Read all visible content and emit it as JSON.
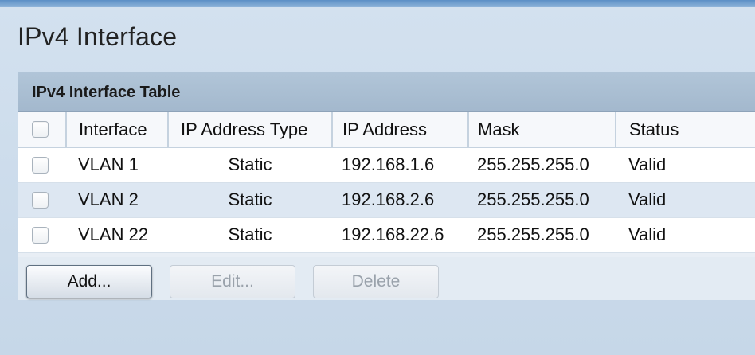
{
  "page": {
    "title": "IPv4 Interface"
  },
  "table": {
    "title": "IPv4 Interface Table",
    "columns": {
      "interface": "Interface",
      "ip_address_type": "IP Address Type",
      "ip_address": "IP Address",
      "mask": "Mask",
      "status": "Status"
    },
    "rows": [
      {
        "interface": "VLAN 1",
        "ip_address_type": "Static",
        "ip_address": "192.168.1.6",
        "mask": "255.255.255.0",
        "status": "Valid",
        "selected": false
      },
      {
        "interface": "VLAN 2",
        "ip_address_type": "Static",
        "ip_address": "192.168.2.6",
        "mask": "255.255.255.0",
        "status": "Valid",
        "selected": false
      },
      {
        "interface": "VLAN 22",
        "ip_address_type": "Static",
        "ip_address": "192.168.22.6",
        "mask": "255.255.255.0",
        "status": "Valid",
        "selected": false
      }
    ]
  },
  "buttons": {
    "add_label": "Add...",
    "edit_label": "Edit...",
    "delete_label": "Delete",
    "edit_enabled": false,
    "delete_enabled": false
  },
  "colors": {
    "page_background": "#c9d9e9",
    "panel_header": "#a3b8cd",
    "row_alt": "#dde7f2",
    "disabled_text": "#9aa2ab"
  }
}
